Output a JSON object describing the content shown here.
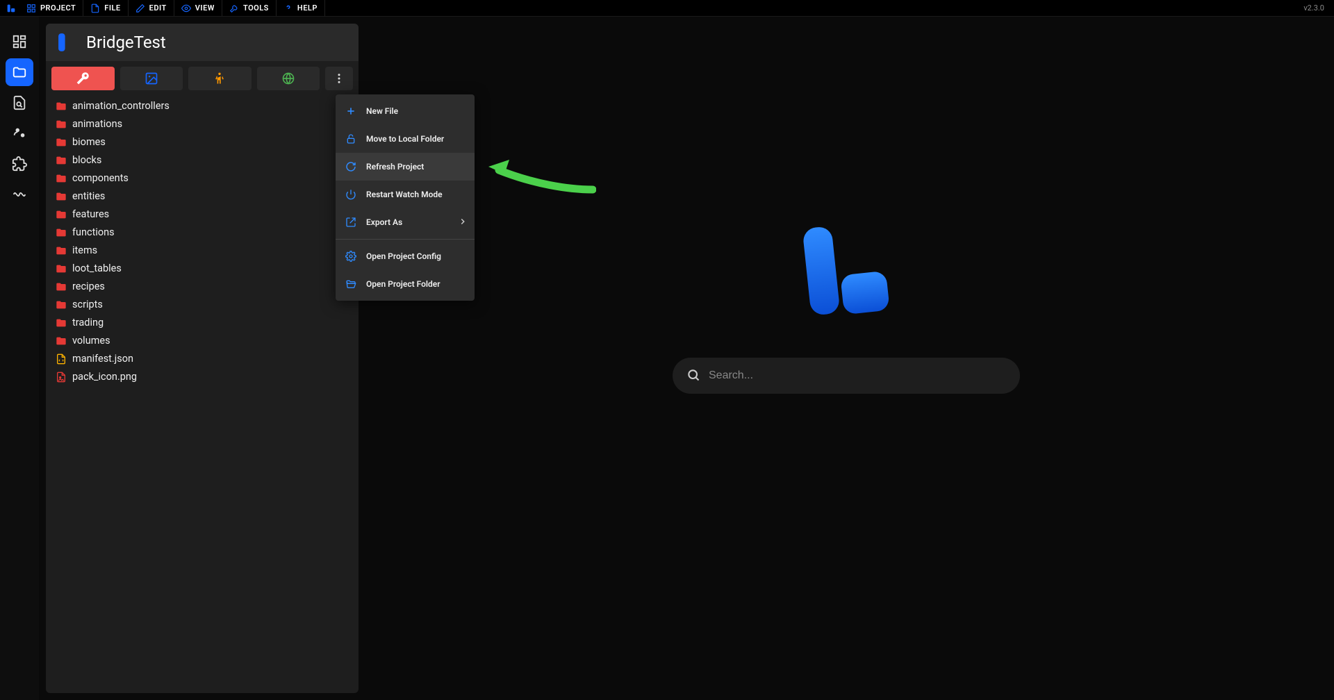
{
  "topbar": {
    "items": [
      {
        "label": "PROJECT"
      },
      {
        "label": "FILE"
      },
      {
        "label": "EDIT"
      },
      {
        "label": "VIEW"
      },
      {
        "label": "TOOLS"
      },
      {
        "label": "HELP"
      }
    ],
    "version": "v2.3.0"
  },
  "panel": {
    "title": "BridgeTest"
  },
  "tree": {
    "items": [
      {
        "label": "animation_controllers",
        "type": "folder"
      },
      {
        "label": "animations",
        "type": "folder"
      },
      {
        "label": "biomes",
        "type": "folder"
      },
      {
        "label": "blocks",
        "type": "folder"
      },
      {
        "label": "components",
        "type": "folder"
      },
      {
        "label": "entities",
        "type": "folder"
      },
      {
        "label": "features",
        "type": "folder"
      },
      {
        "label": "functions",
        "type": "folder"
      },
      {
        "label": "items",
        "type": "folder"
      },
      {
        "label": "loot_tables",
        "type": "folder"
      },
      {
        "label": "recipes",
        "type": "folder"
      },
      {
        "label": "scripts",
        "type": "folder"
      },
      {
        "label": "trading",
        "type": "folder"
      },
      {
        "label": "volumes",
        "type": "folder"
      },
      {
        "label": "manifest.json",
        "type": "json"
      },
      {
        "label": "pack_icon.png",
        "type": "image"
      }
    ]
  },
  "context_menu": {
    "items": [
      {
        "label": "New File",
        "icon": "plus"
      },
      {
        "label": "Move to Local Folder",
        "icon": "lock-open"
      },
      {
        "label": "Refresh Project",
        "icon": "refresh",
        "highlighted": true
      },
      {
        "label": "Restart Watch Mode",
        "icon": "power"
      },
      {
        "label": "Export As",
        "icon": "export",
        "submenu": true
      },
      {
        "divider": true
      },
      {
        "label": "Open Project Config",
        "icon": "gear"
      },
      {
        "label": "Open Project Folder",
        "icon": "folder-open"
      }
    ]
  },
  "search": {
    "placeholder": "Search..."
  },
  "colors": {
    "accent": "#1565ff",
    "active_tab": "#ef5350",
    "folder": "#e53935",
    "arrow": "#4caf50"
  }
}
